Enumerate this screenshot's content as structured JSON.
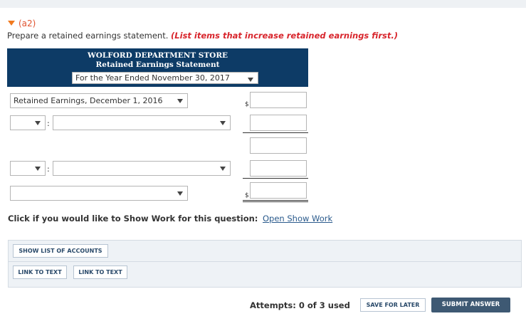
{
  "section": {
    "label": "(a2)"
  },
  "instructions": {
    "text": "Prepare a retained earnings statement. ",
    "note": "(List items that increase retained earnings first.)"
  },
  "statement": {
    "company": "WOLFORD DEPARTMENT STORE",
    "title": "Retained Earnings Statement",
    "period_selected": "For the Year Ended November 30, 2017"
  },
  "rows": {
    "beginning_label": "Retained Earnings, December 1, 2016",
    "dollar": "$",
    "colon": ":"
  },
  "show_work": {
    "prompt": "Click if you would like to Show Work for this question:",
    "link": "Open Show Work"
  },
  "buttons": {
    "show_list": "SHOW LIST OF ACCOUNTS",
    "link_text_1": "LINK TO TEXT",
    "link_text_2": "LINK TO TEXT",
    "save": "SAVE FOR LATER",
    "submit": "SUBMIT ANSWER"
  },
  "attempts": "Attempts: 0 of 3 used",
  "colors": {
    "header_bg": "#0d3b66",
    "accent_orange": "#f07a20",
    "note_red": "#d8262d",
    "submit_bg": "#3e5973",
    "link_blue": "#2a5a8c"
  }
}
